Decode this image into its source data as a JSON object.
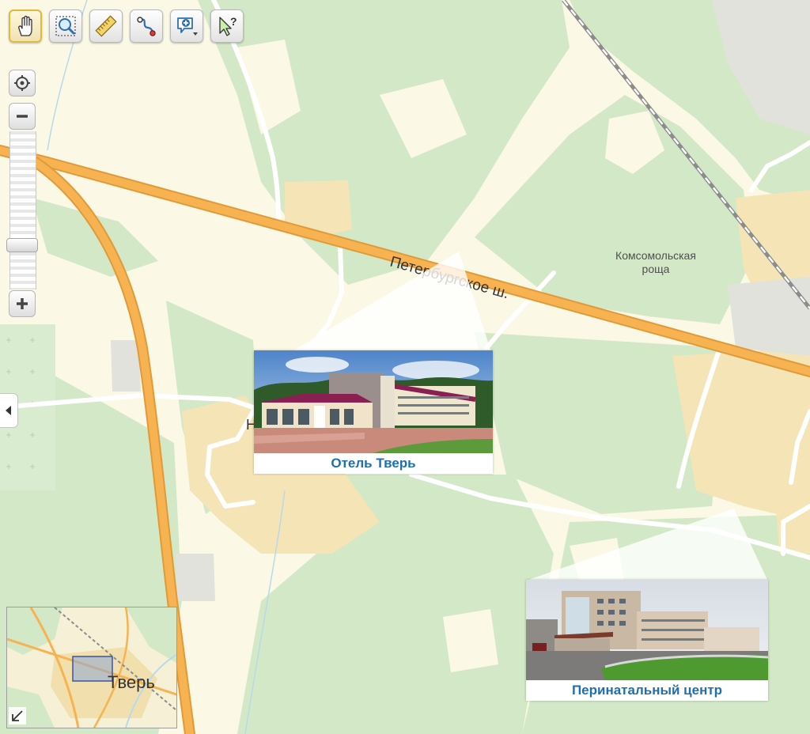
{
  "map": {
    "street_label": "Петербургское ш.",
    "park_label_line1": "Комсомольская",
    "park_label_line2": "роща",
    "partial_label": "Н"
  },
  "toolbar": {
    "tools": [
      {
        "name": "pan-hand",
        "active": true
      },
      {
        "name": "zoom-box",
        "active": false
      },
      {
        "name": "ruler",
        "active": false
      },
      {
        "name": "route",
        "active": false
      },
      {
        "name": "add-marker",
        "active": false
      },
      {
        "name": "help-cursor",
        "active": false
      }
    ]
  },
  "zoom": {
    "level_fraction": 0.26
  },
  "cards": {
    "hotel": {
      "caption": "Отель Тверь"
    },
    "perinatal": {
      "caption": "Перинатальный центр"
    }
  },
  "overview": {
    "city_label": "Тверь"
  },
  "colors": {
    "land": "#fbf8e6",
    "forest": "#d3e8c6",
    "built": "#f5e4b6",
    "road_major": "#f7b252",
    "caption": "#1f6fb0"
  }
}
